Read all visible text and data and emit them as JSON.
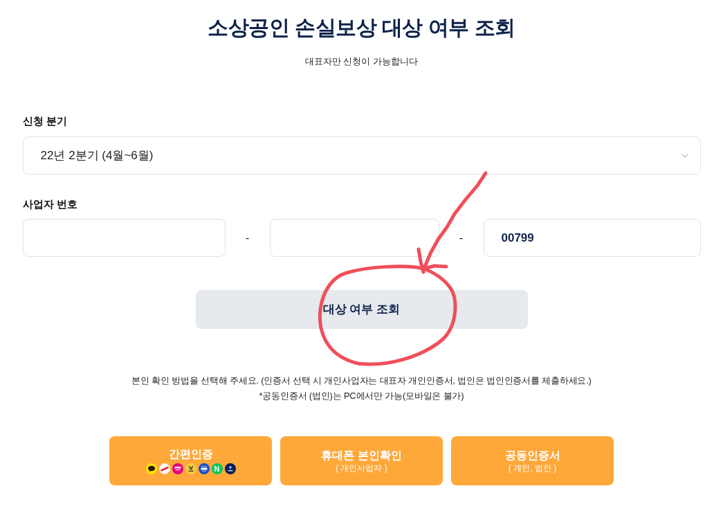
{
  "header": {
    "title": "소상공인 손실보상 대상 여부 조회",
    "subtitle": "대표자만 신청이 가능합니다"
  },
  "form": {
    "quarter": {
      "label": "신청 분기",
      "value": "22년 2분기 (4월~6월)"
    },
    "business_number": {
      "label": "사업자 번호",
      "separators": [
        "-",
        "-"
      ],
      "last_part": "00799"
    },
    "submit_button": {
      "label": "대상 여부 조회"
    }
  },
  "notice": [
    "본인 확인 방법을 선택해 주세요. (인증서 선택 시 개인사업자는 대표자 개인인증서, 법인은 법인인증서를 제출하세요.)",
    "*공동인증서 (법인)는 PC에서만 가능(모바일은 불가)"
  ],
  "auth_methods": [
    {
      "kind": "simple",
      "title": "간편인증",
      "logo_letter": "N"
    },
    {
      "kind": "text",
      "title": "휴대폰 본인확인",
      "subtitle": "( 개인사업자 )"
    },
    {
      "kind": "text",
      "title": "공동인증서",
      "subtitle": "( 개인, 법인 )"
    }
  ],
  "annotations": {
    "arrow": true,
    "circle": true
  }
}
